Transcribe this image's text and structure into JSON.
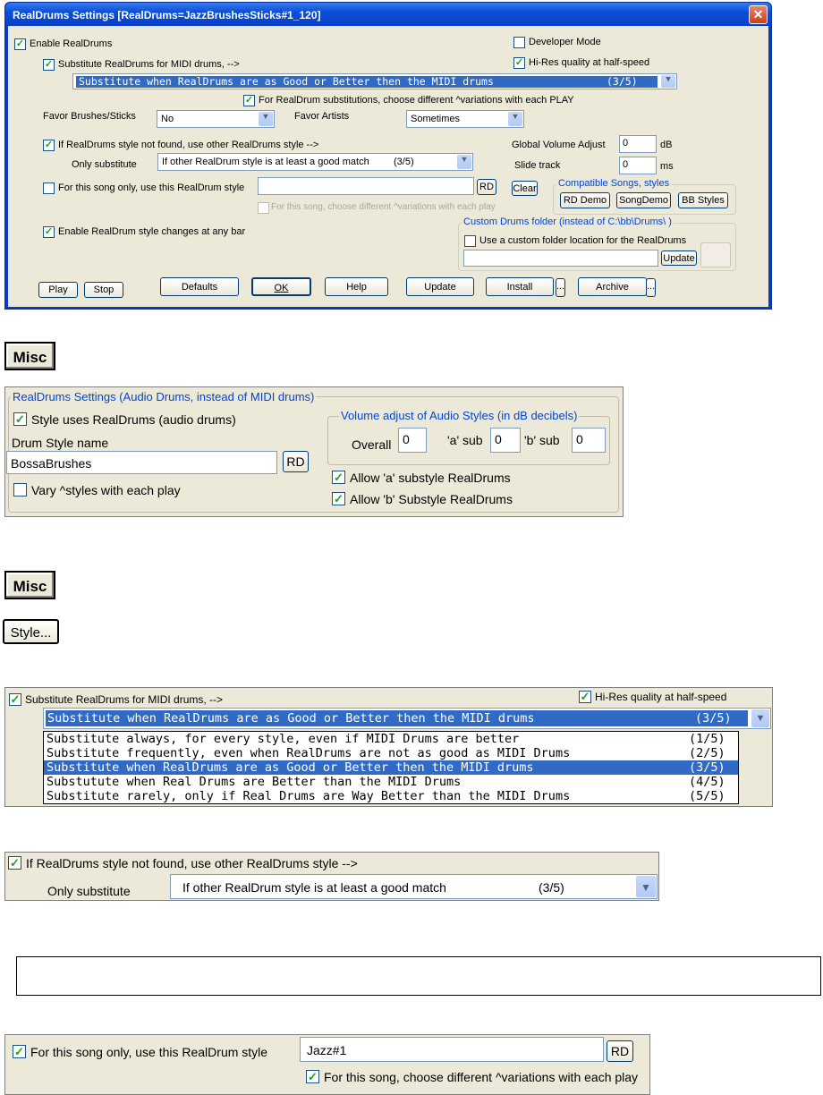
{
  "dialog": {
    "title": "RealDrums Settings [RealDrums=JazzBrushesSticks#1_120]",
    "close": "✕",
    "enable_realdrums": "Enable RealDrums",
    "developer_mode": "Developer Mode",
    "substitute_label": "Substitute RealDrums for MIDI drums, -->",
    "hires_label": "Hi-Res quality at half-speed",
    "substitute_select": {
      "text": "Substitute when RealDrums are as Good or Better then the MIDI drums",
      "rank": "(3/5)"
    },
    "variations_label": "For RealDrum substitutions, choose different ^variations with each PLAY",
    "favor_brushes_label": "Favor Brushes/Sticks",
    "favor_brushes_value": "No",
    "favor_artists_label": "Favor Artists",
    "favor_artists_value": "Sometimes",
    "notfound_label": "If RealDrums style not found, use other RealDrums style -->",
    "only_substitute_label": "Only substitute",
    "only_substitute_value": "If other RealDrum style is at least a good match",
    "only_substitute_rank": "(3/5)",
    "global_volume_label": "Global Volume Adjust",
    "global_volume_value": "0",
    "global_volume_unit": "dB",
    "slide_track_label": "Slide track",
    "slide_track_value": "0",
    "slide_track_unit": "ms",
    "song_only_label": "For this song only, use this RealDrum style",
    "song_only_value": "",
    "rd": "RD",
    "clear": "Clear",
    "song_variations_label": "For this song, choose different ^variations with each play",
    "compatible_group": "Compatible Songs, styles",
    "rd_demo": "RD Demo",
    "song_demo": "SongDemo",
    "bb_styles": "BB Styles",
    "enable_changes_label": "Enable RealDrum style changes at any bar",
    "custom_group": "Custom Drums folder (instead of C:\\bb\\Drums\\ )",
    "custom_folder_label": "Use a custom folder location for the RealDrums",
    "custom_folder_value": "",
    "update_small": "Update",
    "buttons": {
      "play": "Play",
      "stop": "Stop",
      "defaults": "Defaults",
      "ok": "OK",
      "help": "Help",
      "update": "Update",
      "install": "Install",
      "more": "...",
      "archive": "Archive"
    }
  },
  "misc1": "Misc",
  "panel1": {
    "group": "RealDrums Settings (Audio Drums, instead of MIDI drums)",
    "style_uses": "Style uses RealDrums (audio drums)",
    "drum_style_name_label": "Drum Style name",
    "drum_style_name_value": "BossaBrushes",
    "rd": "RD",
    "vary_label": "Vary ^styles with each play",
    "volume_group": "Volume adjust of Audio Styles (in dB decibels)",
    "overall_label": "Overall",
    "overall_value": "0",
    "a_sub_label": "'a' sub",
    "a_sub_value": "0",
    "b_sub_label": "'b' sub",
    "b_sub_value": "0",
    "allow_a": "Allow 'a' substyle RealDrums",
    "allow_b": "Allow 'b' Substyle RealDrums"
  },
  "misc2": "Misc",
  "style_button": "Style...",
  "dropdown_panel": {
    "substitute_label": "Substitute RealDrums for MIDI drums, -->",
    "hires_label": "Hi-Res quality at half-speed",
    "selected": {
      "text": "Substitute when RealDrums are as Good or Better then the MIDI drums",
      "rank": "(3/5)"
    },
    "options": [
      {
        "text": "Substitute always, for every style, even if MIDI Drums are better",
        "rank": "(1/5)"
      },
      {
        "text": "Substitute frequently, even when RealDrums are not as good as MIDI Drums",
        "rank": "(2/5)"
      },
      {
        "text": "Substitute when RealDrums are as Good or Better then the MIDI drums",
        "rank": "(3/5)"
      },
      {
        "text": "Substutute when Real Drums are Better than the MIDI Drums",
        "rank": "(4/5)"
      },
      {
        "text": "Substitute rarely, only if Real Drums are Way Better than the MIDI Drums",
        "rank": "(5/5)"
      }
    ]
  },
  "notfound_panel": {
    "label": "If RealDrums style not found, use other RealDrums style -->",
    "only_substitute_label": "Only substitute",
    "value": "If other RealDrum style is at least a good match",
    "rank": "(3/5)"
  },
  "song_panel": {
    "label": "For this song only, use this RealDrum style",
    "value": "Jazz#1",
    "rd": "RD",
    "variations_label": "For this song, choose different ^variations with each play"
  }
}
